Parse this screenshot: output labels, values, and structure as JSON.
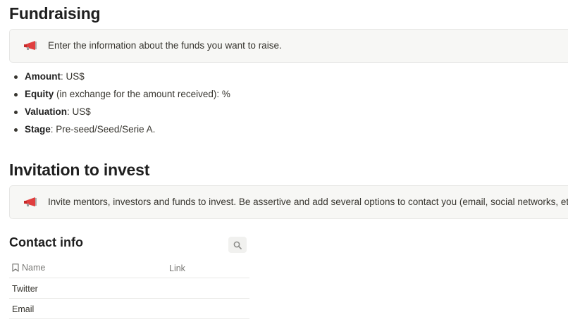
{
  "fundraising": {
    "title": "Fundraising",
    "callout": {
      "icon": "megaphone-icon",
      "text": "Enter the information about the funds you want to raise."
    },
    "items": [
      {
        "label": "Amount",
        "value": ": US$"
      },
      {
        "label": "Equity",
        "value": " (in exchange for the amount received): %"
      },
      {
        "label": "Valuation",
        "value": ": US$"
      },
      {
        "label": "Stage",
        "value": ": Pre-seed/Seed/Serie A."
      }
    ]
  },
  "invitation": {
    "title": "Invitation to invest",
    "callout": {
      "icon": "megaphone-icon",
      "text": "Invite mentors, investors and funds to invest. Be assertive and add several options to contact you (email, social networks, etc.)"
    }
  },
  "contact": {
    "title": "Contact info",
    "search_icon": "search-icon",
    "columns": {
      "name": "Name",
      "link": "Link",
      "name_icon": "bookmark-icon"
    },
    "rows": [
      {
        "name": "Twitter",
        "link": ""
      },
      {
        "name": "Email",
        "link": ""
      }
    ]
  },
  "colors": {
    "accent": "#e03e3e",
    "callout_bg": "#f7f7f5"
  }
}
